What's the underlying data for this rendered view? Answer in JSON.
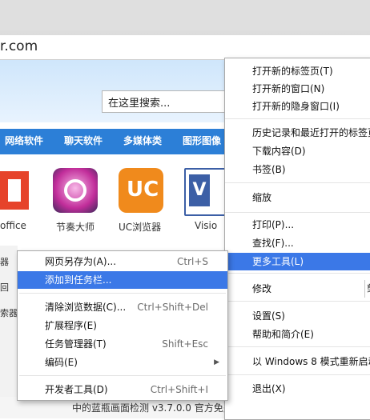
{
  "address_bar": {
    "url": "r.com"
  },
  "page": {
    "search_placeholder": "在这里搜索...",
    "categories": [
      "网络软件",
      "聊天软件",
      "多媒体类",
      "图形图像"
    ],
    "apps": [
      {
        "name": "office",
        "icon": "office-icon"
      },
      {
        "name": "节奏大师",
        "icon": "rhythm-master-icon"
      },
      {
        "name": "UC浏览器",
        "icon": "uc-browser-icon"
      },
      {
        "name": "Visio",
        "icon": "visio-icon"
      }
    ],
    "left_fragments": [
      "器",
      "回",
      "索器"
    ],
    "bottom_fragment": "中的蓝瓶画面检测 v3.7.0.0 官方免费版"
  },
  "main_menu": {
    "items": [
      {
        "label": "打开新的标签页(T)"
      },
      {
        "label": "打开新的窗口(N)"
      },
      {
        "label": "打开新的隐身窗口(I)"
      },
      {
        "label": "历史记录和最近打开的标签页"
      },
      {
        "label": "下载内容(D)"
      },
      {
        "label": "书签(B)"
      },
      {
        "label": "缩放"
      },
      {
        "label": "打印(P)..."
      },
      {
        "label": "查找(F)..."
      },
      {
        "label": "更多工具(L)"
      },
      {
        "label": "修改"
      },
      {
        "label": "设置(S)"
      },
      {
        "label": "帮助和简介(E)"
      },
      {
        "label": "以 Windows 8 模式重新启动"
      },
      {
        "label": "退出(X)"
      }
    ],
    "edit_suffix": "剪"
  },
  "sub_menu": {
    "items": [
      {
        "label": "网页另存为(A)...",
        "shortcut": "Ctrl+S"
      },
      {
        "label": "添加到任务栏...",
        "shortcut": ""
      },
      {
        "label": "清除浏览数据(C)...",
        "shortcut": "Ctrl+Shift+Del"
      },
      {
        "label": "扩展程序(E)",
        "shortcut": ""
      },
      {
        "label": "任务管理器(T)",
        "shortcut": "Shift+Esc"
      },
      {
        "label": "编码(E)",
        "shortcut": ""
      },
      {
        "label": "开发者工具(D)",
        "shortcut": "Ctrl+Shift+I"
      }
    ]
  },
  "colors": {
    "highlight": "#3b78e7",
    "category_bar": "#2c7fd7"
  }
}
